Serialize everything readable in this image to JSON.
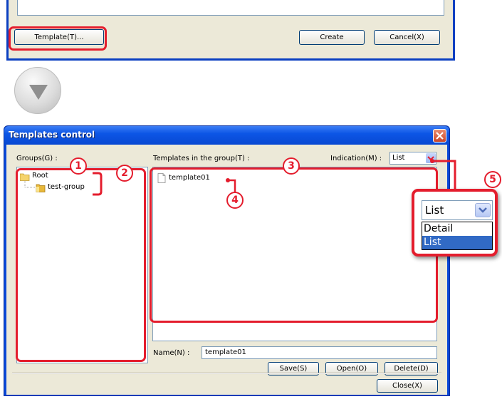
{
  "top_dialog": {
    "template_button": "Template(T)...",
    "create_button": "Create",
    "cancel_button": "Cancel(X)"
  },
  "dialog": {
    "title": "Templates control",
    "groups_label": "Groups(G) :",
    "templates_label": "Templates in the group(T) :",
    "indication_label": "Indication(M) :",
    "indication_value": "List",
    "tree": [
      {
        "label": "Root",
        "icon": "folder-open-icon"
      },
      {
        "label": "test-group",
        "icon": "folder-icon"
      }
    ],
    "templates": [
      {
        "label": "template01",
        "icon": "document-icon"
      }
    ],
    "name_label": "Name(N) :",
    "name_value": "template01",
    "save_button": "Save(S)",
    "open_button": "Open(O)",
    "delete_button": "Delete(D)",
    "close_button": "Close(X)"
  },
  "callout": {
    "selected": "List",
    "options": [
      "Detail",
      "List"
    ],
    "highlighted_option": "List"
  },
  "annotations": [
    "1",
    "2",
    "3",
    "4",
    "5"
  ],
  "colors": {
    "annotation_red": "#e41d2d",
    "titlebar_blue": "#0a48d8",
    "dialog_face": "#ece9d8",
    "selection_blue": "#316ac5"
  }
}
